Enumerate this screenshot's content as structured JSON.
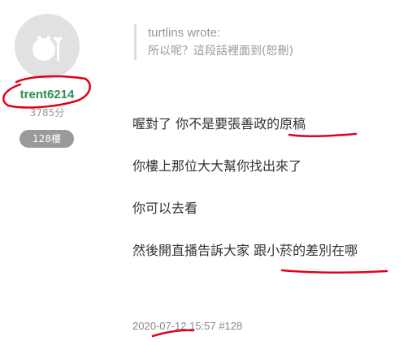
{
  "user": {
    "name": "trent6214",
    "score": "3785分",
    "floor_badge": "128樓"
  },
  "quote": {
    "author": "turtlins wrote:",
    "text": "所以呢？這段話裡面到(恕刪)"
  },
  "post": {
    "lines": [
      "喔對了 你不是要張善政的原稿",
      "你樓上那位大大幫你找出來了",
      "你可以去看",
      "然後開直播告訴大家 跟小菸的差別在哪"
    ]
  },
  "meta": {
    "text": "2020-07-12 15:57 #128"
  },
  "colors": {
    "username": "#2e8b57",
    "annotation": "#e0001a",
    "badge": "#9a9a9a"
  }
}
